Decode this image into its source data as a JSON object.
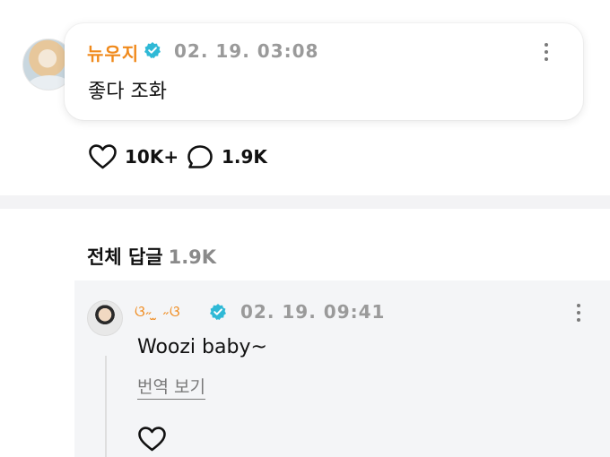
{
  "post": {
    "author": "뉴우지",
    "timestamp": "02. 19. 03:08",
    "text": "좋다 조화",
    "likes": "10K+",
    "replies": "1.9K"
  },
  "replies_section": {
    "title": "전체 답글",
    "count": "1.9K"
  },
  "reply": {
    "author": "ଓ˶ ̫ ˶ଓ",
    "timestamp": "02. 19. 09:41",
    "text": "Woozi baby~",
    "translate_label": "번역 보기"
  },
  "colors": {
    "author_name": "#f08a1c",
    "verified_badge": "#2fb9d6",
    "muted_text": "#9a9a9a",
    "reply_background": "#f4f5f7"
  },
  "icons": [
    "heart-icon",
    "comment-bubble-icon",
    "more-vertical-icon",
    "verified-badge-icon"
  ]
}
